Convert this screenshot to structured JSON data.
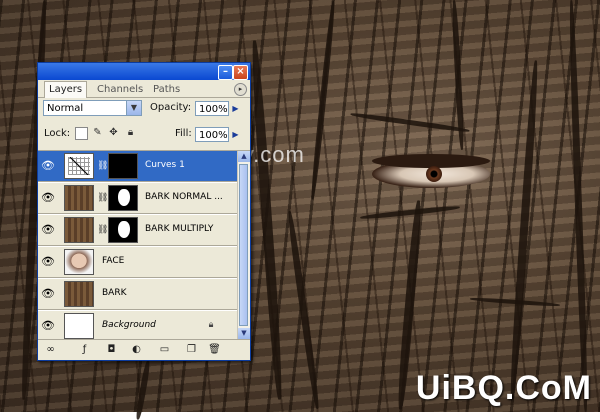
{
  "background": {
    "watermark_text": "www.psfly.com",
    "brand_text": "UiBQ.CoM",
    "colors": {
      "bark_dark": "#3d2e22",
      "bark_light": "#7a6450"
    }
  },
  "panel": {
    "tabs": [
      {
        "label": "Layers",
        "active": true
      },
      {
        "label": "Channels",
        "active": false
      },
      {
        "label": "Paths",
        "active": false
      }
    ],
    "menu_icon": "panel-menu-icon",
    "blend_mode": "Normal",
    "opacity_label": "Opacity:",
    "opacity_value": "100%",
    "lock_label": "Lock:",
    "fill_label": "Fill:",
    "fill_value": "100%",
    "layers": [
      {
        "name": "Curves 1",
        "thumbnail": "curves-icon",
        "has_mask": true,
        "selected": true,
        "visible": true
      },
      {
        "name": "BARK NORMAL ...",
        "thumbnail": "bark",
        "has_mask": true,
        "selected": false,
        "visible": true
      },
      {
        "name": "BARK MULTIPLY",
        "thumbnail": "bark",
        "has_mask": true,
        "selected": false,
        "visible": true
      },
      {
        "name": "FACE",
        "thumbnail": "face",
        "has_mask": false,
        "selected": false,
        "visible": true
      },
      {
        "name": "BARK",
        "thumbnail": "bark",
        "has_mask": false,
        "selected": false,
        "visible": true
      },
      {
        "name": "Background",
        "thumbnail": "white",
        "has_mask": false,
        "selected": false,
        "visible": true,
        "locked": true,
        "italic": true
      }
    ],
    "accent_color": "#316ac5"
  }
}
